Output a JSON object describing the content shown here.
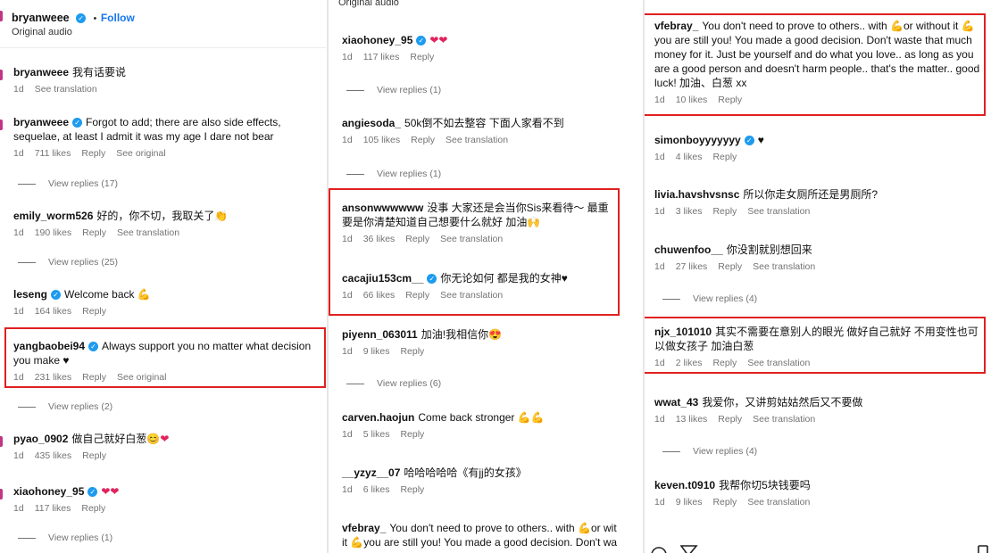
{
  "panel1": {
    "header": {
      "user": "bryanweee",
      "dot": "•",
      "follow": "Follow",
      "audio": "Original audio"
    },
    "comments": [
      {
        "user": "bryanweee",
        "text": "我有话要说",
        "time": "1d",
        "likes": "",
        "reply": "",
        "action": "See translation"
      },
      {
        "user": "bryanweee",
        "text": "Forgot to add; there are also side effects, sequelae, at least I admit it was my age I dare not bear",
        "time": "1d",
        "likes": "711 likes",
        "reply": "Reply",
        "action": "See original"
      },
      {
        "user": "emily_worm526",
        "text": "好的，你不切，我取关了",
        "time": "1d",
        "likes": "190 likes",
        "reply": "Reply",
        "action": "See translation"
      },
      {
        "user": "leseng",
        "text": "Welcome back",
        "time": "1d",
        "likes": "164 likes",
        "reply": "Reply",
        "action": ""
      },
      {
        "user": "yangbaobei94",
        "text": "Always support you no matter what decision you make",
        "time": "1d",
        "likes": "231 likes",
        "reply": "Reply",
        "action": "See original"
      },
      {
        "user": "pyao_0902",
        "text": "做自己就好白葱",
        "time": "1d",
        "likes": "435 likes",
        "reply": "Reply",
        "action": ""
      },
      {
        "user": "xiaohoney_95",
        "text": "",
        "time": "1d",
        "likes": "117 likes",
        "reply": "Reply",
        "action": ""
      }
    ],
    "view_replies": [
      "View replies (17)",
      "View replies (25)",
      "View replies (2)",
      "View replies (1)"
    ]
  },
  "panel2": {
    "header": {
      "audio": "Original audio"
    },
    "comments": [
      {
        "user": "xiaohoney_95",
        "text": "",
        "time": "1d",
        "likes": "117 likes",
        "reply": "Reply",
        "action": ""
      },
      {
        "user": "angiesoda_",
        "text": "50k倒不如去整容 下面人家看不到",
        "time": "1d",
        "likes": "105 likes",
        "reply": "Reply",
        "action": "See translation"
      },
      {
        "user": "ansonwwwwww",
        "text": "没事 大家还是会当你Sis来看待～ 最重要是你清楚知道自己想要什么就好 加油",
        "time": "1d",
        "likes": "36 likes",
        "reply": "Reply",
        "action": "See translation"
      },
      {
        "user": "cacajiu153cm__",
        "text": "你无论如何 都是我的女神",
        "time": "1d",
        "likes": "66 likes",
        "reply": "Reply",
        "action": "See translation"
      },
      {
        "user": "piyenn_063011",
        "text": "加油!我相信你",
        "time": "1d",
        "likes": "9 likes",
        "reply": "Reply",
        "action": ""
      },
      {
        "user": "carven.haojun",
        "text": "Come back stronger",
        "time": "1d",
        "likes": "5 likes",
        "reply": "Reply",
        "action": ""
      },
      {
        "user": "__yzyz__07",
        "text": "哈哈哈哈哈《有jj的女孩》",
        "time": "1d",
        "likes": "6 likes",
        "reply": "Reply",
        "action": ""
      },
      {
        "user": "vfebray_",
        "text_a": "You don't need to prove to others.. with",
        "text_b": "or wit",
        "text_c": "it",
        "text_d": "you are still you! You made a good decision. Don't wa"
      }
    ],
    "view_replies": [
      "View replies (1)",
      "View replies (1)",
      "View replies (6)"
    ]
  },
  "panel3": {
    "comments": [
      {
        "user": "vfebray_",
        "text_a": "You don't need to prove to others.. with",
        "text_b": "or without",
        "text_c": "it",
        "text_d": "you are still you! You made a good decision. Don't waste that much money for it. Just be yourself and do what you love.. as long as you are a good person and doesn't harm people.. that's the matter.. good luck! 加油、白葱 xx",
        "time": "1d",
        "likes": "10 likes",
        "reply": "Reply",
        "action": ""
      },
      {
        "user": "simonboyyyyyyy",
        "text": "",
        "time": "1d",
        "likes": "4 likes",
        "reply": "Reply",
        "action": ""
      },
      {
        "user": "livia.havshvsnsc",
        "text": "所以你走女厕所还是男厕所?",
        "time": "1d",
        "likes": "3 likes",
        "reply": "Reply",
        "action": "See translation"
      },
      {
        "user": "chuwenfoo__",
        "text": "你没割就别想回来",
        "time": "1d",
        "likes": "27 likes",
        "reply": "Reply",
        "action": "See translation"
      },
      {
        "user": "njx_101010",
        "text": "其实不需要在意别人的眼光 做好自己就好 不用变性也可以做女孩子 加油白葱",
        "time": "1d",
        "likes": "2 likes",
        "reply": "Reply",
        "action": "See translation"
      },
      {
        "user": "wwat_43",
        "text": "我爱你，又讲剪姑姑然后又不要做",
        "time": "1d",
        "likes": "13 likes",
        "reply": "Reply",
        "action": "See translation"
      },
      {
        "user": "keven.t0910",
        "text": "我帮你切5块钱要吗",
        "time": "1d",
        "likes": "9 likes",
        "reply": "Reply",
        "action": "See translation"
      }
    ],
    "view_replies": [
      "View replies (4)",
      "View replies (4)"
    ]
  },
  "colors": {
    "highlight": "#e02020",
    "verified": "#1d9bf0",
    "muted": "#737373",
    "follow": "#1877f2"
  },
  "icons": {
    "verified": "verified-badge-icon",
    "heart": "red-heart-emoji",
    "muscle": "flexed-biceps-emoji"
  }
}
